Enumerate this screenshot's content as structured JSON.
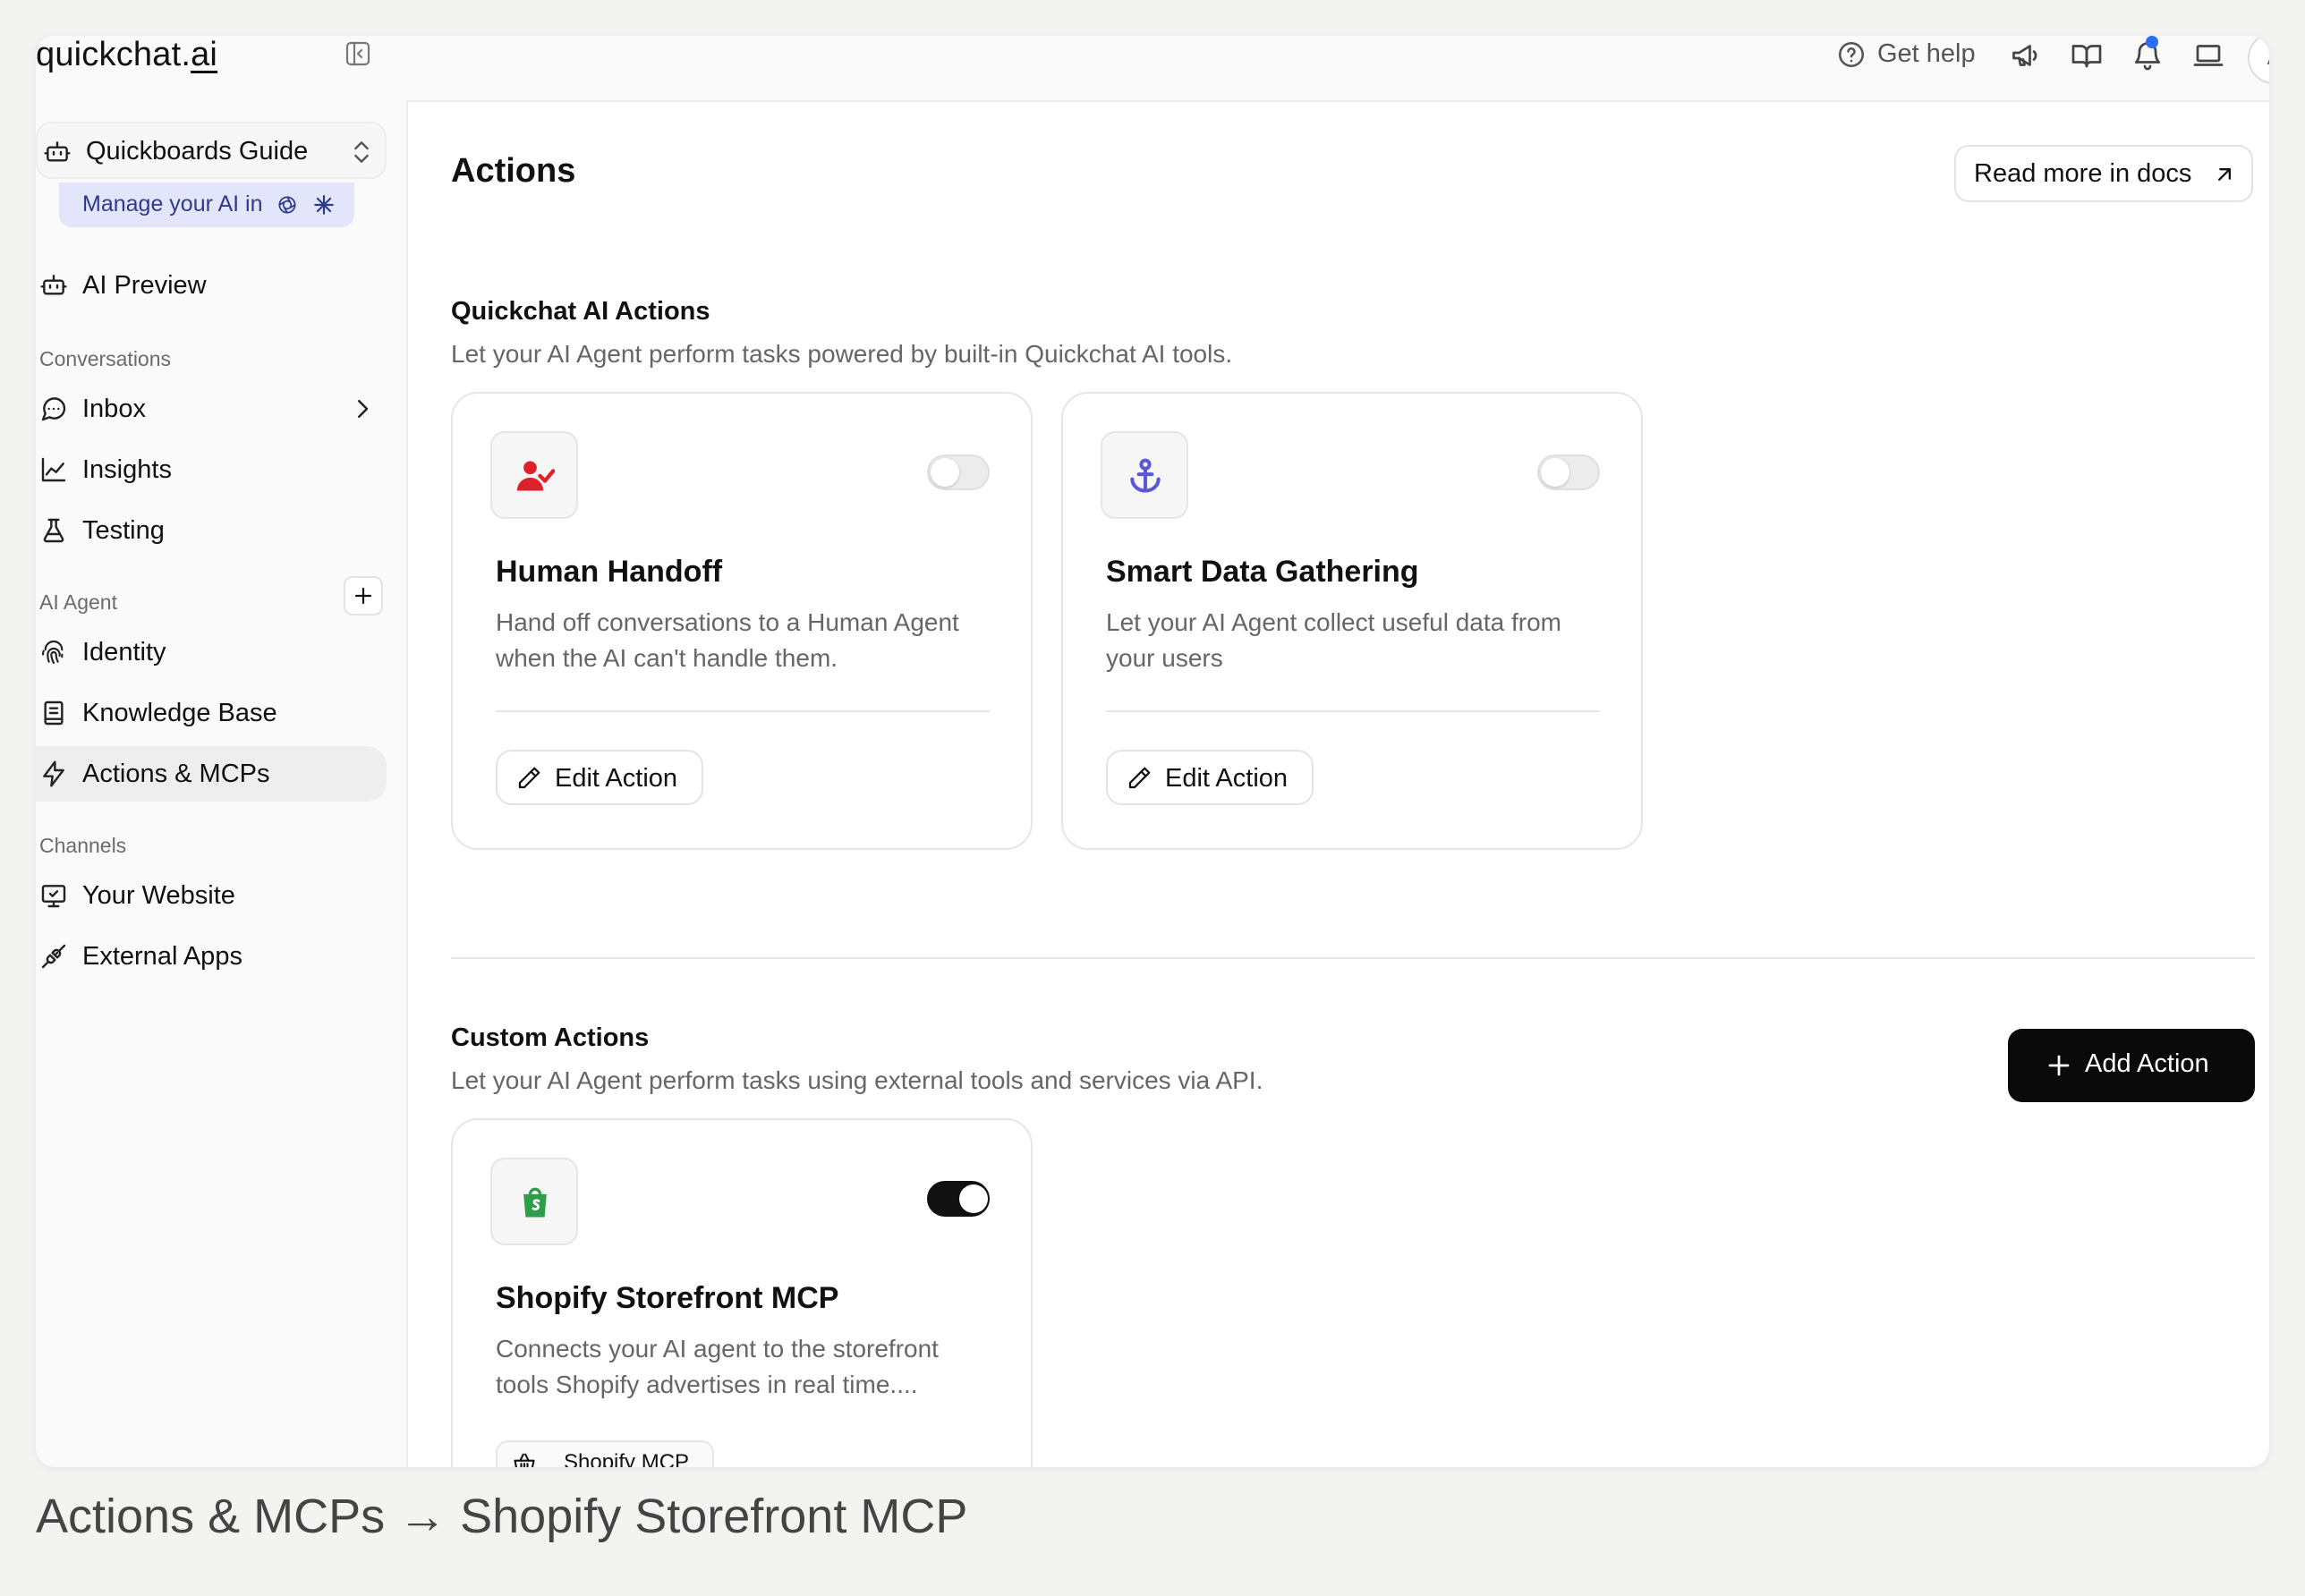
{
  "sidebar": {
    "logo_main": "quickchat.",
    "logo_ai": "ai",
    "workspace": "Quickboards Guide",
    "manage_text": "Manage your AI in",
    "ai_preview": "AI Preview",
    "sections": {
      "conversations": "Conversations",
      "ai_agent": "AI Agent",
      "channels": "Channels"
    },
    "items": {
      "inbox": "Inbox",
      "insights": "Insights",
      "testing": "Testing",
      "identity": "Identity",
      "knowledge_base": "Knowledge Base",
      "actions_mcps": "Actions & MCPs",
      "your_website": "Your Website",
      "external_apps": "External Apps"
    }
  },
  "topbar": {
    "help_label": "Get help",
    "avatar_initial": "A"
  },
  "main": {
    "title": "Actions",
    "docs_button": "Read more in docs",
    "builtin": {
      "title": "Quickchat AI Actions",
      "description": "Let your AI Agent perform tasks powered by built-in Quickchat AI tools.",
      "cards": [
        {
          "title": "Human Handoff",
          "description": "Hand off conversations to a Human Agent when the AI can't handle them.",
          "button": "Edit Action",
          "enabled": false
        },
        {
          "title": "Smart Data Gathering",
          "description": "Let your AI Agent collect useful data from your users",
          "button": "Edit Action",
          "enabled": false
        }
      ]
    },
    "custom": {
      "title": "Custom Actions",
      "description": "Let your AI Agent perform tasks using external tools and services via API.",
      "add_button": "Add Action",
      "cards": [
        {
          "title": "Shopify Storefront MCP",
          "description": "Connects your AI agent to the storefront tools Shopify advertises in real time....",
          "tag": "Shopify MCP",
          "enabled": true
        }
      ]
    }
  },
  "caption": "Actions & MCPs → Shopify Storefront MCP",
  "colors": {
    "accent_blue": "#2a6ef5",
    "handoff_red": "#e0202a",
    "anchor_purple": "#5b57d9",
    "shopify_green": "#2e9e4a",
    "primary_black": "#0a0a0a"
  }
}
